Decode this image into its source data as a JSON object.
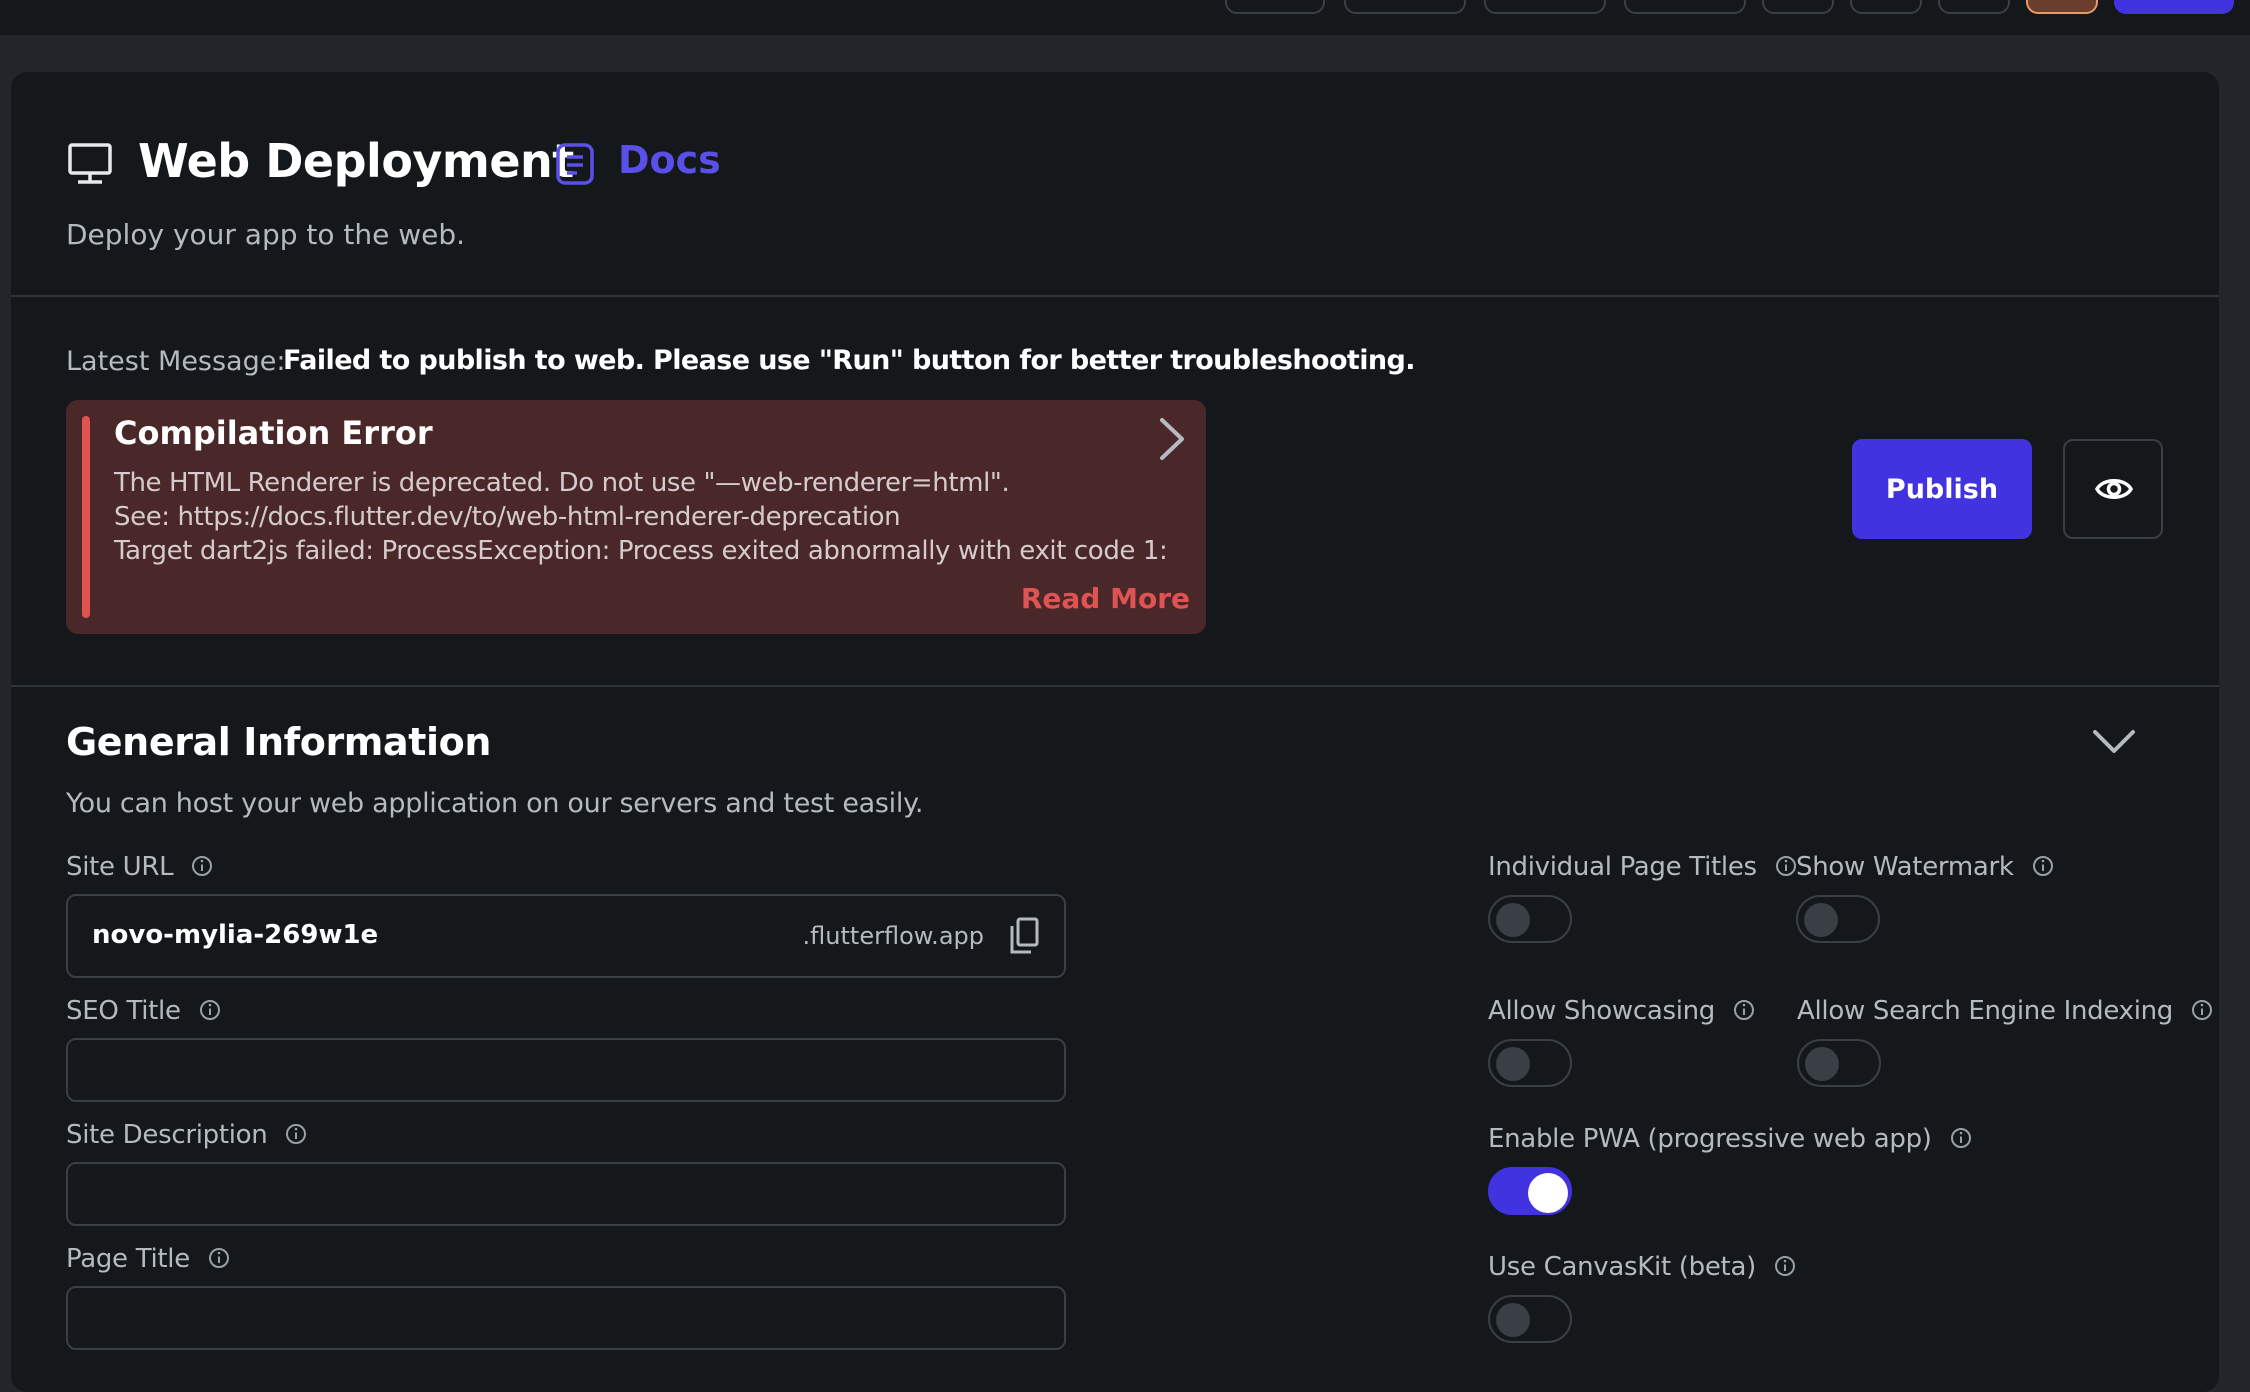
{
  "colors": {
    "accent": "#4233e0",
    "error": "#e05353",
    "panel": "#14181b",
    "background": "#22262b"
  },
  "header": {
    "title": "Web Deployment",
    "docs_label": "Docs",
    "subtitle": "Deploy your app to the web."
  },
  "latest": {
    "label": "Latest Message:",
    "value": "Failed to publish to web. Please use \"Run\" button for better troubleshooting."
  },
  "error": {
    "title": "Compilation Error",
    "lines": [
      "The HTML Renderer is deprecated. Do not use \"—web-renderer=html\".",
      "See: https://docs.flutter.dev/to/web-html-renderer-deprecation",
      "Target dart2js failed: ProcessException: Process exited abnormally with exit code 1:"
    ],
    "read_more": "Read More"
  },
  "actions": {
    "publish_label": "Publish",
    "preview_icon": "eye-icon"
  },
  "general": {
    "title": "General Information",
    "subtitle": "You can host your web application on our servers and test easily.",
    "site_url": {
      "label": "Site URL",
      "value": "novo-mylia-269w1e",
      "suffix": ".flutterflow.app"
    },
    "seo_title": {
      "label": "SEO Title",
      "value": ""
    },
    "site_description": {
      "label": "Site Description",
      "value": ""
    },
    "page_title": {
      "label": "Page Title",
      "value": ""
    }
  },
  "toggles": {
    "individual_page_titles": {
      "label": "Individual Page Titles",
      "on": false
    },
    "show_watermark": {
      "label": "Show Watermark",
      "on": false
    },
    "allow_showcasing": {
      "label": "Allow Showcasing",
      "on": false
    },
    "allow_search_engine_indexing": {
      "label": "Allow Search Engine Indexing",
      "on": false
    },
    "enable_pwa": {
      "label": "Enable PWA (progressive web app)",
      "on": true
    },
    "use_canvaskit": {
      "label": "Use CanvasKit (beta)",
      "on": false
    }
  }
}
